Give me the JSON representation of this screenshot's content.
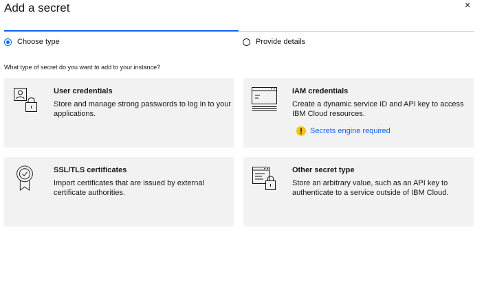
{
  "modal": {
    "title": "Add a secret",
    "close_glyph": "×"
  },
  "progress": {
    "steps": [
      {
        "label": "Choose type",
        "state": "current"
      },
      {
        "label": "Provide details",
        "state": "incomplete"
      }
    ]
  },
  "question": "What type of secret do you want to add to your instance?",
  "tiles": [
    {
      "title": "User credentials",
      "description": "Store and manage strong passwords to log in to your applications.",
      "icon": "user-lock-icon"
    },
    {
      "title": "IAM credentials",
      "description": "Create a dynamic service ID and API key to access IBM Cloud resources.",
      "icon": "service-id-icon",
      "warning": {
        "text": "Secrets engine required",
        "icon": "warning-icon"
      }
    },
    {
      "title": "SSL/TLS certificates",
      "description": "Import certificates that are issued by external certificate authorities.",
      "icon": "certificate-icon"
    },
    {
      "title": "Other secret type",
      "description": "Store an arbitrary value, such as an API key to authenticate to a service outside of IBM Cloud.",
      "icon": "document-lock-icon"
    }
  ],
  "colors": {
    "accent": "#0f62fe",
    "tile_background": "#f2f2f2",
    "warning": "#f1c21b"
  }
}
